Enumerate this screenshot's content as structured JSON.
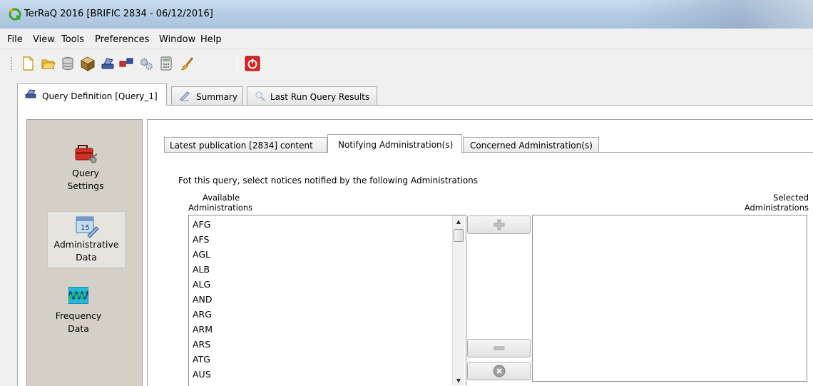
{
  "window": {
    "title": "TerRaQ 2016 [BRIFIC 2834 - 06/12/2016]"
  },
  "menu": {
    "items": [
      "File",
      "View",
      "Tools",
      "Preferences",
      "Window",
      "Help"
    ]
  },
  "toolbar": {
    "icons": [
      "new-icon",
      "open-icon",
      "database-icon",
      "package-icon",
      "query-icon",
      "network-icon",
      "gears-icon",
      "calculator-icon",
      "brush-icon",
      "power-icon"
    ]
  },
  "tabs": [
    {
      "label": "Query Definition [Query_1]",
      "icon": "query-icon",
      "active": true
    },
    {
      "label": "Summary",
      "icon": "pen-icon",
      "active": false
    },
    {
      "label": "Last Run Query Results",
      "icon": "search-icon",
      "active": false
    }
  ],
  "sidebar": {
    "items": [
      {
        "label_lines": [
          "Query",
          "Settings"
        ],
        "icon": "toolbox-icon",
        "active": false
      },
      {
        "label_lines": [
          "Administrative",
          "Data"
        ],
        "icon": "calendar-icon",
        "active": true
      },
      {
        "label_lines": [
          "Frequency",
          "Data"
        ],
        "icon": "waveform-icon",
        "active": false
      }
    ]
  },
  "subtabs": [
    {
      "label": "Latest publication [2834] content",
      "active": false
    },
    {
      "label": "Notifying Administration(s)",
      "active": true
    },
    {
      "label": "Concerned Administration(s)",
      "active": false
    }
  ],
  "panel": {
    "instruction": "Fot this query, select notices notified by the following Administrations",
    "available_label_lines": [
      "Available",
      "Administrations"
    ],
    "selected_label_lines": [
      "Selected",
      "Administrations"
    ],
    "available": [
      "AFG",
      "AFS",
      "AGL",
      "ALB",
      "ALG",
      "AND",
      "ARG",
      "ARM",
      "ARS",
      "ATG",
      "AUS"
    ],
    "selected": [],
    "buttons": {
      "add": "plus-icon",
      "remove": "minus-icon",
      "clear": "clear-icon"
    }
  },
  "colors": {
    "accent_red": "#e02020",
    "sidebar_bg": "#d4d0c8",
    "titlebar": "#b7cde4"
  }
}
